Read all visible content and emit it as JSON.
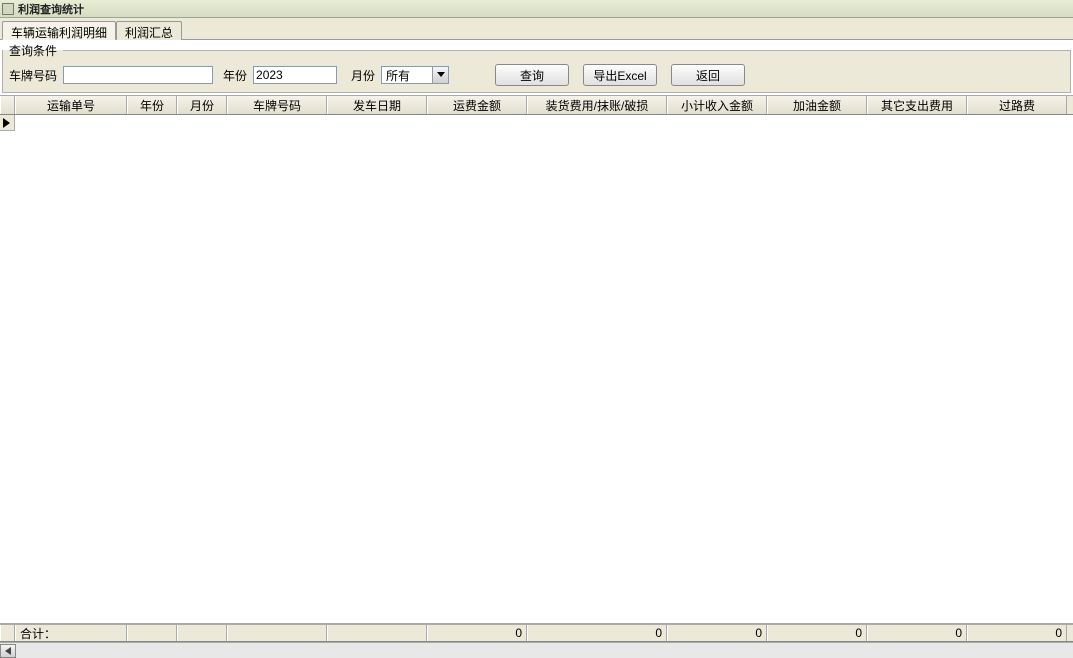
{
  "window": {
    "title": "利润查询统计"
  },
  "tabs": {
    "detail": "车辆运输利润明细",
    "summary": "利润汇总"
  },
  "query": {
    "legend": "查询条件",
    "plate_label": "车牌号码",
    "plate_value": "",
    "year_label": "年份",
    "year_value": "2023",
    "month_label": "月份",
    "month_value": "所有",
    "query_btn": "查询",
    "export_btn": "导出Excel",
    "back_btn": "返回"
  },
  "grid": {
    "columns": [
      "运输单号",
      "年份",
      "月份",
      "车牌号码",
      "发车日期",
      "运费金额",
      "装货费用/抹账/破损",
      "小计收入金额",
      "加油金额",
      "其它支出费用",
      "过路费"
    ],
    "footer": {
      "label": "合计：",
      "values": [
        "",
        "",
        "",
        "",
        "",
        "0",
        "0",
        "0",
        "0",
        "0",
        "0"
      ]
    }
  }
}
